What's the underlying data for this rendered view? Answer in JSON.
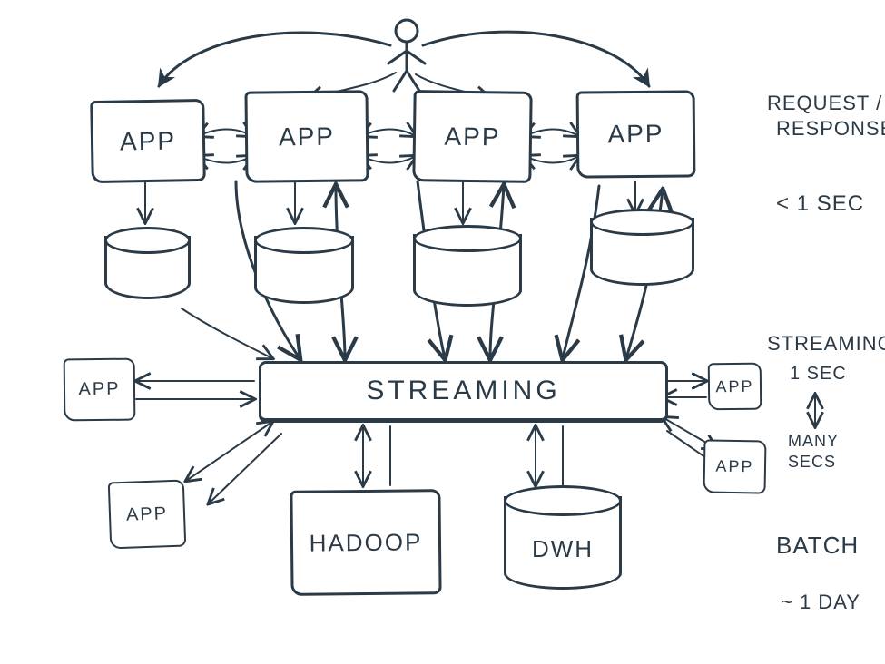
{
  "diagram": {
    "actor": "user",
    "topRow": {
      "app1": "APP",
      "app2": "APP",
      "app3": "APP",
      "app4": "APP"
    },
    "leftApps": {
      "mid": "APP",
      "lower": "APP"
    },
    "rightApps": {
      "mid": "APP",
      "lower": "APP"
    },
    "center": "STREAMING",
    "bottom": {
      "hadoop": "HADOOP",
      "dwh": "DWH"
    },
    "databases": {
      "db1": "",
      "db2": "",
      "db3": "",
      "db4": ""
    }
  },
  "annotations": {
    "layer1_a": "REQUEST /",
    "layer1_b": "RESPONSE",
    "layer1_time": "< 1 SEC",
    "layer2_title": "STREAMING",
    "layer2_top": "1 SEC",
    "layer2_bottom": "MANY\nSECS",
    "layer3_title": "BATCH",
    "layer3_time": "~ 1 DAY"
  }
}
